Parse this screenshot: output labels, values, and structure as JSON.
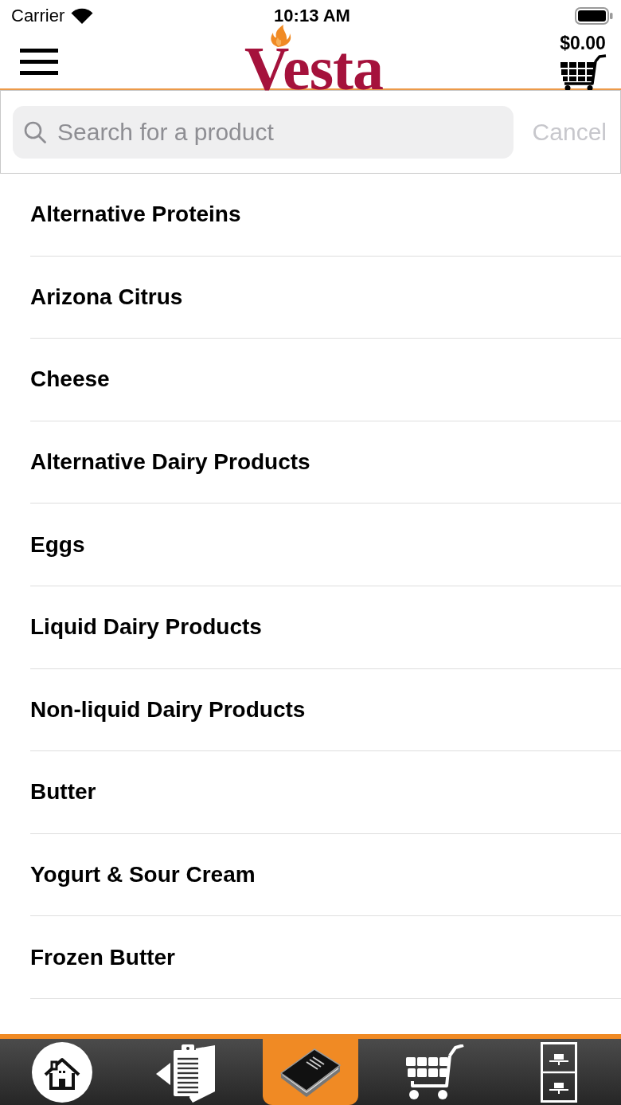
{
  "status_bar": {
    "carrier": "Carrier",
    "time": "10:13 AM"
  },
  "header": {
    "logo": "Vesta",
    "cart_total": "$0.00"
  },
  "search": {
    "placeholder": "Search for a product",
    "cancel": "Cancel"
  },
  "categories": [
    "Alternative Proteins",
    "Arizona Citrus",
    "Cheese",
    "Alternative Dairy Products",
    "Eggs",
    "Liquid Dairy Products",
    "Non-liquid Dairy Products",
    "Butter",
    "Yogurt & Sour Cream",
    "Frozen Butter"
  ],
  "tab_bar": {
    "tabs": [
      {
        "kind": "home",
        "selected": false
      },
      {
        "kind": "orders",
        "selected": false
      },
      {
        "kind": "catalog",
        "selected": true
      },
      {
        "kind": "cart",
        "selected": false
      },
      {
        "kind": "files",
        "selected": false
      }
    ]
  }
}
